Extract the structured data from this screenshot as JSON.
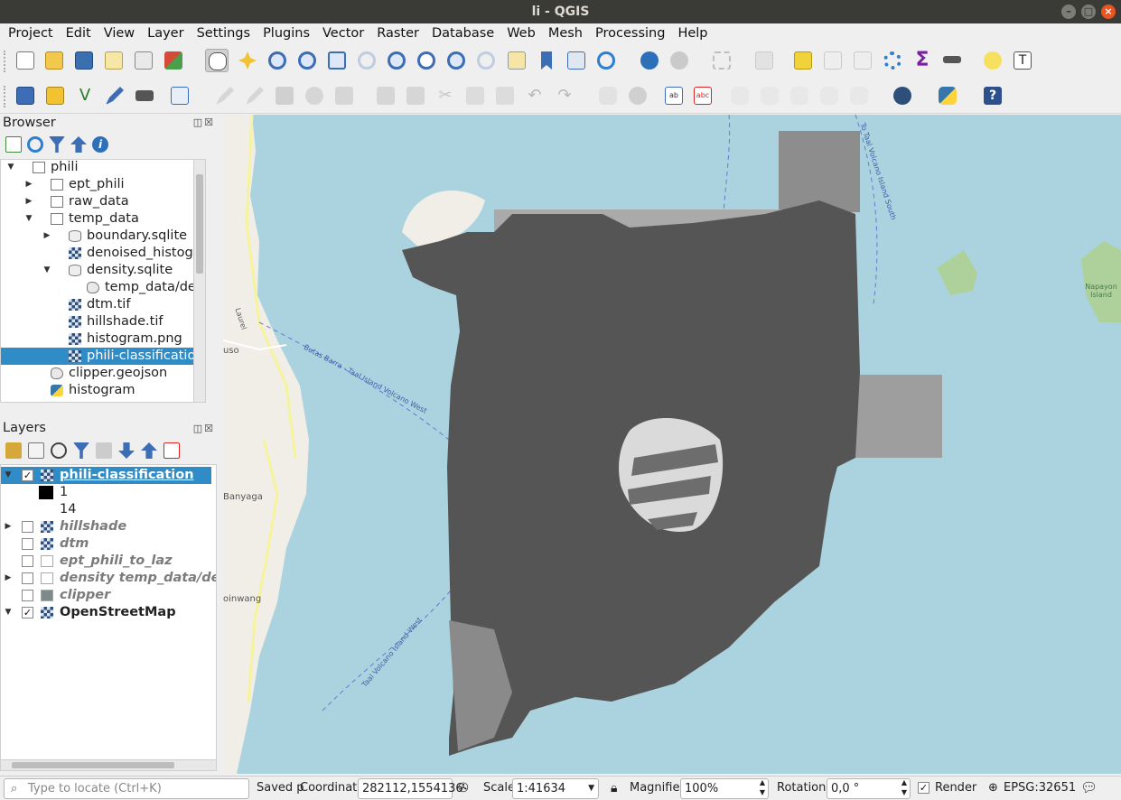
{
  "window": {
    "title": "li - QGIS"
  },
  "menubar": [
    "Project",
    "Edit",
    "View",
    "Layer",
    "Settings",
    "Plugins",
    "Vector",
    "Raster",
    "Database",
    "Web",
    "Mesh",
    "Processing",
    "Help"
  ],
  "browser": {
    "title": "Browser",
    "items": [
      {
        "label": "phili",
        "expander": "▼",
        "icon": "folder-icon"
      },
      {
        "label": "ept_phili",
        "expander": "▶",
        "icon": "folder-icon"
      },
      {
        "label": "raw_data",
        "expander": "▶",
        "icon": "folder-icon"
      },
      {
        "label": "temp_data",
        "expander": "▼",
        "icon": "folder-icon"
      },
      {
        "label": "boundary.sqlite",
        "expander": "▶",
        "icon": "database-icon"
      },
      {
        "label": "denoised_histogram",
        "expander": "",
        "icon": "raster-icon"
      },
      {
        "label": "density.sqlite",
        "expander": "▼",
        "icon": "database-icon"
      },
      {
        "label": "temp_data/density",
        "expander": "",
        "icon": "polygon-icon"
      },
      {
        "label": "dtm.tif",
        "expander": "",
        "icon": "raster-icon"
      },
      {
        "label": "hillshade.tif",
        "expander": "",
        "icon": "raster-icon"
      },
      {
        "label": "histogram.png",
        "expander": "",
        "icon": "raster-icon"
      },
      {
        "label": "phili-classification",
        "expander": "",
        "icon": "raster-icon",
        "selected": true
      },
      {
        "label": "clipper.geojson",
        "expander": "",
        "icon": "polygon-icon"
      },
      {
        "label": "histogram",
        "expander": "",
        "icon": "python-icon"
      }
    ]
  },
  "layers": {
    "title": "Layers",
    "items": [
      {
        "label": "phili-classification",
        "checked": "✓",
        "expander": "▼"
      },
      {
        "label": "1",
        "legend": "black"
      },
      {
        "label": "14",
        "legend": "white"
      },
      {
        "label": "hillshade",
        "checked": "",
        "expander": "▶"
      },
      {
        "label": "dtm",
        "checked": "",
        "expander": ""
      },
      {
        "label": "ept_phili_to_laz",
        "checked": "",
        "expander": ""
      },
      {
        "label": "density temp_data/density",
        "checked": "",
        "expander": "▶"
      },
      {
        "label": "clipper",
        "checked": "",
        "expander": ""
      },
      {
        "label": "OpenStreetMap",
        "checked": "✓",
        "expander": "▼"
      }
    ]
  },
  "map": {
    "labels": [
      "To Taal Volcano Island South",
      "Butas Barra - Taal Island Volcano West",
      "Taal Volcano Island West",
      "Napayon Island",
      "Laurel",
      "uso",
      "Banyaga",
      "oinwang"
    ]
  },
  "status": {
    "search_placeholder": "Type to locate (Ctrl+K)",
    "saved": "Saved p",
    "coordinate_label": "Coordinate",
    "coordinate": "282112,1554136",
    "scale_label": "Scale",
    "scale": "1:41634",
    "magnifier_label": "Magnifier",
    "magnifier": "100%",
    "rotation_label": "Rotation",
    "rotation": "0,0 °",
    "render_label": "Render",
    "render_checked": "✓",
    "crs": "EPSG:32651"
  }
}
